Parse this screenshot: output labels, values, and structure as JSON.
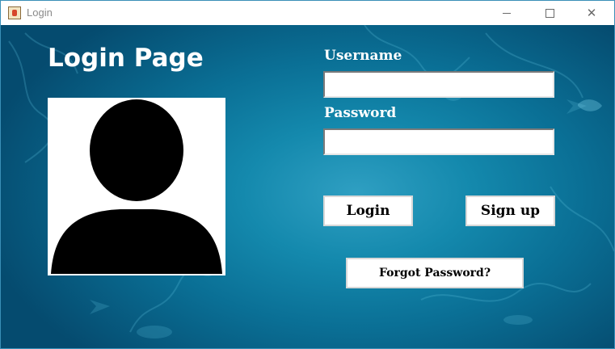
{
  "window": {
    "title": "Login",
    "icon": "java-cup-icon",
    "controls": [
      "minimize",
      "maximize",
      "close"
    ],
    "close_glyph": "✕"
  },
  "page": {
    "heading": "Login Page"
  },
  "form": {
    "username_label": "Username",
    "username_value": "",
    "password_label": "Password",
    "password_value": ""
  },
  "buttons": {
    "login": "Login",
    "signup": "Sign up",
    "forgot": "Forgot Password?"
  },
  "colors": {
    "background_dark": "#054b6f",
    "background_mid": "#1489ad",
    "background_light": "#2f9fc2",
    "title_text": "#ffffff"
  }
}
